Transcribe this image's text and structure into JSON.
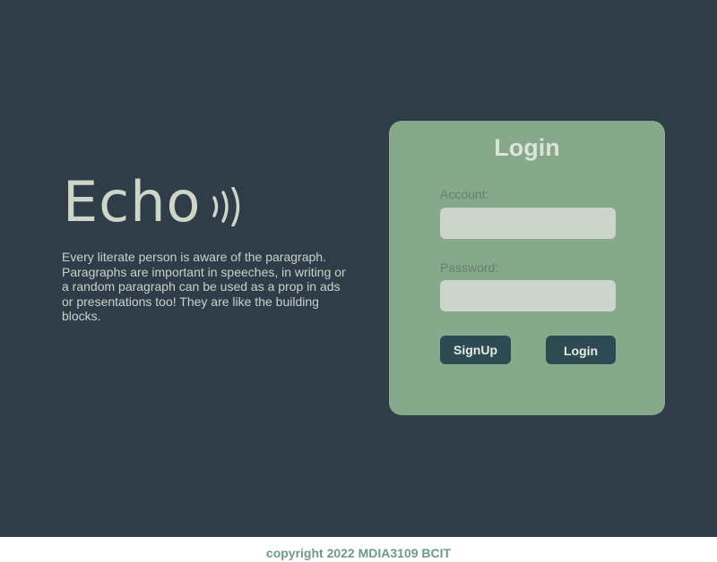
{
  "brand": {
    "name": "Echo",
    "icon": "sound-waves-icon",
    "color": "#cdd6c8"
  },
  "intro": {
    "text": "Every literate person is aware of the paragraph. Paragraphs are important in speeches, in writing or a random paragraph can be used as a prop in ads or presentations too! They are like the building blocks."
  },
  "login_card": {
    "title": "Login",
    "account_label": "Account:",
    "account_value": "",
    "password_label": "Password:",
    "password_value": "",
    "signup_label": "SignUp",
    "login_label": "Login"
  },
  "footer": {
    "text": "copyright 2022 MDIA3109 BCIT"
  },
  "colors": {
    "background": "#2e3d47",
    "card": "#86a98b",
    "button": "#2e4a52",
    "input": "#ccd5c9",
    "footer_text": "#6d9a8a"
  }
}
